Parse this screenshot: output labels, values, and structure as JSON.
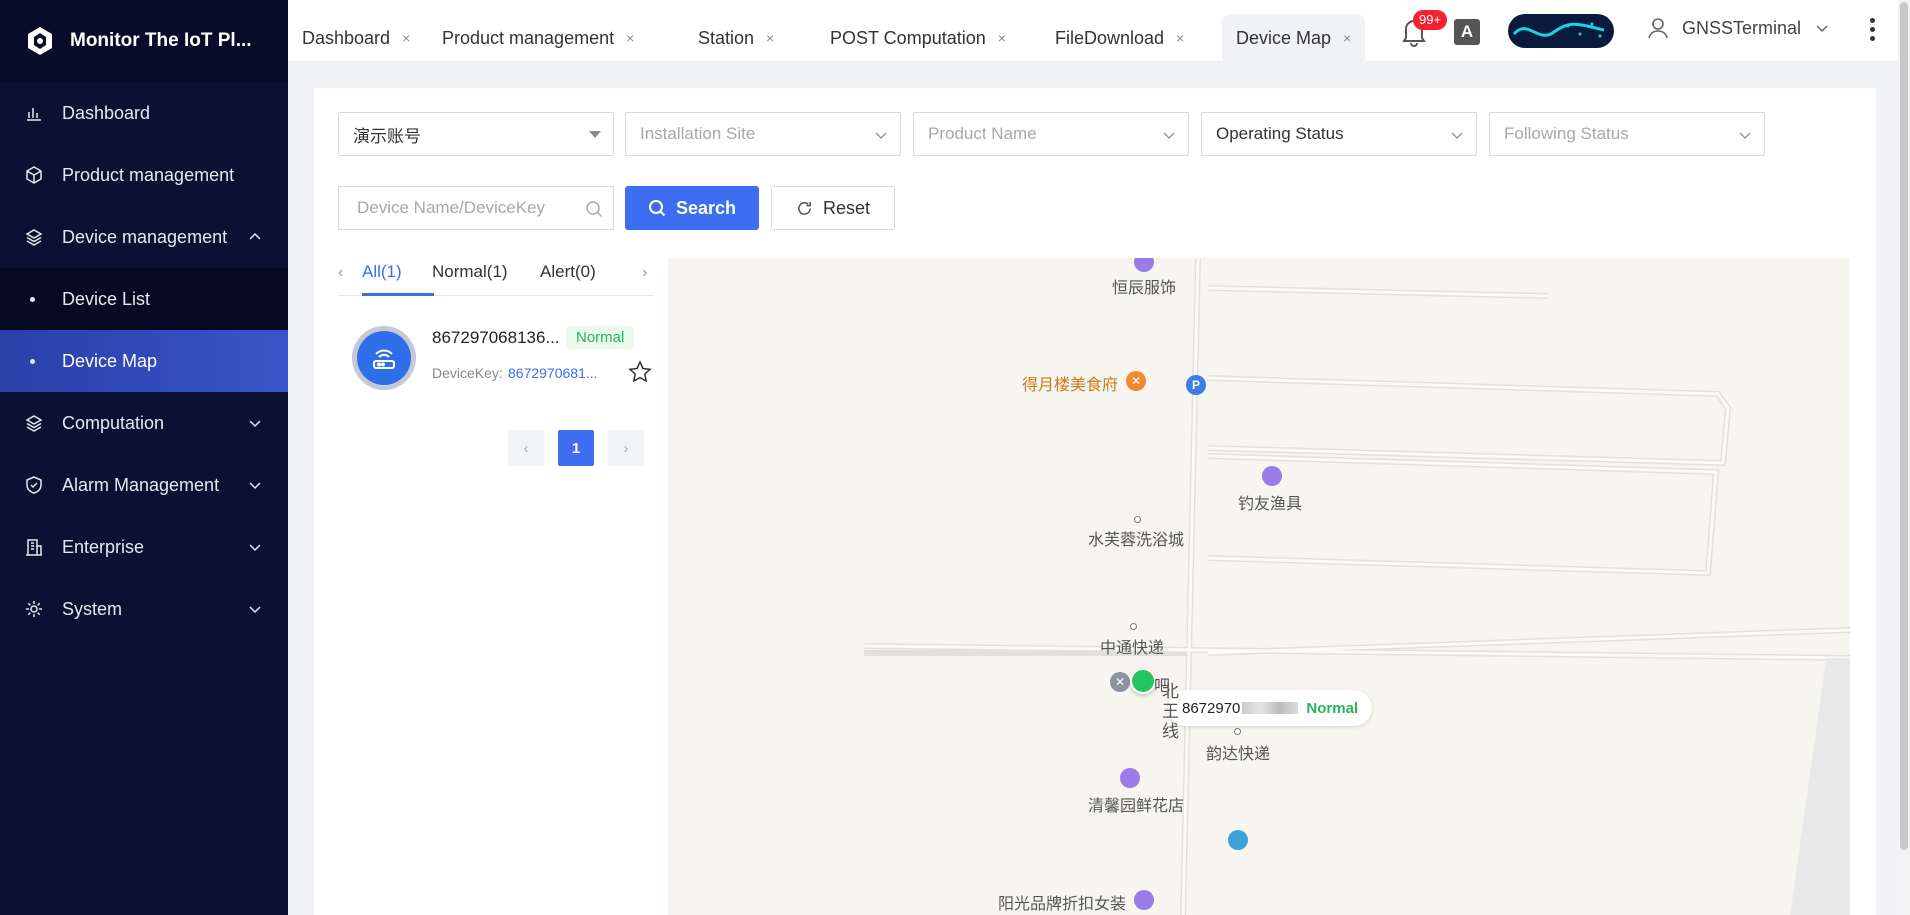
{
  "app": {
    "title": "Monitor The IoT Pl..."
  },
  "sidebar": {
    "items": [
      {
        "label": "Dashboard",
        "icon": "chart-bar-icon"
      },
      {
        "label": "Product management",
        "icon": "cube-icon"
      },
      {
        "label": "Device management",
        "icon": "layers-icon",
        "expanded": true
      },
      {
        "label": "Device List",
        "sub": true
      },
      {
        "label": "Device Map",
        "sub": true,
        "active": true
      },
      {
        "label": "Computation",
        "icon": "layers-icon"
      },
      {
        "label": "Alarm Management",
        "icon": "shield-icon"
      },
      {
        "label": "Enterprise",
        "icon": "building-icon"
      },
      {
        "label": "System",
        "icon": "gear-icon"
      }
    ]
  },
  "tabs": [
    {
      "label": "Dashboard",
      "close": "×"
    },
    {
      "label": "Product management",
      "close": "×"
    },
    {
      "label": "Station",
      "close": "×"
    },
    {
      "label": "POST Computation",
      "close": "×"
    },
    {
      "label": "FileDownload",
      "close": "×"
    },
    {
      "label": "Device Map",
      "close": "×",
      "active": true
    }
  ],
  "header": {
    "notification_badge": "99+",
    "translate_glyph": "A",
    "user_name": "GNSSTerminal"
  },
  "filters": {
    "account": "演示账号",
    "installation_site": "Installation Site",
    "product_name": "Product Name",
    "operating_status": "Operating Status",
    "following_status": "Following Status",
    "search_placeholder": "Device Name/DeviceKey",
    "search_button": "Search",
    "reset_button": "Reset"
  },
  "list": {
    "tabs": [
      {
        "label": "All(1)",
        "active": true
      },
      {
        "label": "Normal(1)"
      },
      {
        "label": "Alert(0)"
      }
    ],
    "prev_arrow": "‹",
    "next_arrow": "›",
    "devices": [
      {
        "name": "867297068136...",
        "status": "Normal",
        "key_label": "DeviceKey:",
        "key": "8672970681..."
      }
    ],
    "pagination": {
      "current": "1",
      "prev": "‹",
      "next": "›"
    }
  },
  "map": {
    "pois": [
      {
        "name": "恒辰服饰"
      },
      {
        "name": "得月楼美食府"
      },
      {
        "name": "钓友渔具"
      },
      {
        "name": "水芙蓉洗浴城"
      },
      {
        "name": "中通快递"
      },
      {
        "name": "吧"
      },
      {
        "name": "韵达快递"
      },
      {
        "name": "清馨园鲜花店"
      },
      {
        "name": "阳光品牌折扣女装"
      }
    ],
    "road_label": "北王线",
    "parking_glyph": "P",
    "popup": {
      "device_prefix": "8672970",
      "status": "Normal"
    }
  },
  "colors": {
    "primary": "#3d6ef2",
    "sidebar_bg": "#0b1132",
    "normal": "#2ab45a",
    "badge": "#f5222d"
  }
}
